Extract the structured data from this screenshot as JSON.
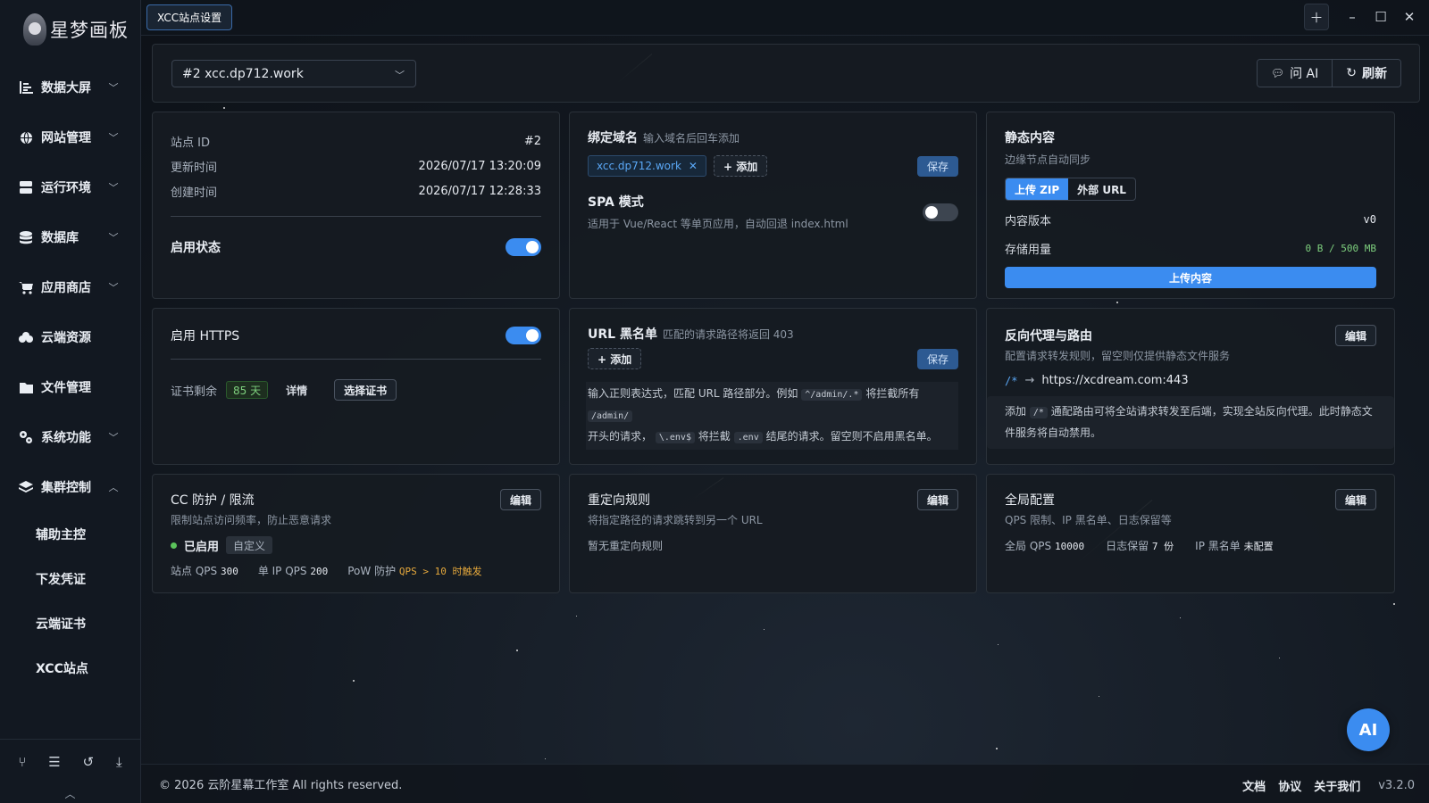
{
  "app": {
    "logo_text": "星梦画板"
  },
  "sidebar": {
    "items": [
      {
        "label": "数据大屏",
        "icon": "chart-bar-icon",
        "chevron": "down"
      },
      {
        "label": "网站管理",
        "icon": "globe-icon",
        "chevron": "down"
      },
      {
        "label": "运行环境",
        "icon": "server-icon",
        "chevron": "down"
      },
      {
        "label": "数据库",
        "icon": "database-icon",
        "chevron": "down"
      },
      {
        "label": "应用商店",
        "icon": "cart-icon",
        "chevron": "down"
      },
      {
        "label": "云端资源",
        "icon": "cloud-icon"
      },
      {
        "label": "文件管理",
        "icon": "folder-icon"
      },
      {
        "label": "系统功能",
        "icon": "gears-icon",
        "chevron": "down"
      },
      {
        "label": "集群控制",
        "icon": "layers-icon",
        "chevron": "up"
      }
    ],
    "subitems": [
      "辅助主控",
      "下发凭证",
      "云端证书",
      "XCC站点"
    ],
    "bottom_icons": [
      "share-icon",
      "list-icon",
      "history-icon",
      "download-icon"
    ]
  },
  "topbar": {
    "tab_label": "XCC站点设置"
  },
  "sitebar": {
    "selected_site": "#2 xcc.dp712.work",
    "ask_ai_label": "问 AI",
    "refresh_label": "刷新"
  },
  "site_info": {
    "id_label": "站点 ID",
    "id_value": "#2",
    "updated_label": "更新时间",
    "updated_value": "2026/07/17 13:20:09",
    "created_label": "创建时间",
    "created_value": "2026/07/17 12:28:33",
    "enabled_label": "启用状态",
    "enabled": true
  },
  "domains": {
    "title": "绑定域名",
    "hint": "输入域名后回车添加",
    "tags": [
      "xcc.dp712.work"
    ],
    "add_label": "+ 添加",
    "save_label": "保存",
    "spa_title": "SPA 模式",
    "spa_desc": "适用于 Vue/React 等单页应用，自动回退 index.html",
    "spa_enabled": false
  },
  "static": {
    "title": "静态内容",
    "subtitle": "边缘节点自动同步",
    "upload_zip": "上传 ZIP",
    "external_url": "外部 URL",
    "version_label": "内容版本",
    "version_value": "v0",
    "storage_label": "存储用量",
    "storage_value": "0 B / 500 MB",
    "upload_button": "上传内容"
  },
  "https": {
    "title": "启用 HTTPS",
    "enabled": true,
    "cert_label": "证书剩余",
    "cert_days": "85 天",
    "detail_label": "详情",
    "choose_cert": "选择证书"
  },
  "blacklist": {
    "title": "URL 黑名单",
    "hint": "匹配的请求路径将返回 403",
    "add_label": "+ 添加",
    "save_label": "保存",
    "info_1": "输入正则表达式，匹配 URL 路径部分。例如",
    "code_1": "^/admin/.*",
    "info_2": "将拦截所有",
    "code_2": "/admin/",
    "info_3": "开头的请求，",
    "code_3": "\\.env$",
    "info_4": "将拦截",
    "code_4": ".env",
    "info_5": "结尾的请求。留空则不启用黑名单。"
  },
  "proxy": {
    "title": "反向代理与路由",
    "subtitle": "配置请求转发规则，留空则仅提供静态文件服务",
    "edit_label": "编辑",
    "route_path": "/*",
    "route_arrow": "→",
    "route_target": "https://xcdream.com:443",
    "info_1": "添加",
    "info_code": "/*",
    "info_2": "通配路由可将全站请求转发至后端，实现全站反向代理。此时静态文件服务将自动禁用。"
  },
  "cc": {
    "title": "CC 防护 / 限流",
    "subtitle": "限制站点访问频率，防止恶意请求",
    "edit_label": "编辑",
    "status_label": "已启用",
    "mode_tag": "自定义",
    "site_qps_label": "站点 QPS",
    "site_qps": "300",
    "ip_qps_label": "单 IP QPS",
    "ip_qps": "200",
    "pow_label": "PoW 防护",
    "pow_value": "QPS > 10 时触发"
  },
  "redirect": {
    "title": "重定向规则",
    "subtitle": "将指定路径的请求跳转到另一个 URL",
    "edit_label": "编辑",
    "empty": "暂无重定向规则"
  },
  "global": {
    "title": "全局配置",
    "subtitle": "QPS 限制、IP 黑名单、日志保留等",
    "edit_label": "编辑",
    "qps_label": "全局 QPS",
    "qps": "10000",
    "log_label": "日志保留",
    "log": "7 份",
    "ipbl_label": "IP 黑名单",
    "ipbl": "未配置"
  },
  "footer": {
    "copyright": "© 2026 云阶星幕工作室 All rights reserved.",
    "docs": "文档",
    "agreement": "协议",
    "about": "关于我们",
    "version": "v3.2.0"
  },
  "fab": {
    "label": "AI"
  },
  "colors": {
    "accent": "#3b8cf0",
    "success": "#5bc35b",
    "warning": "#e5a83c"
  }
}
